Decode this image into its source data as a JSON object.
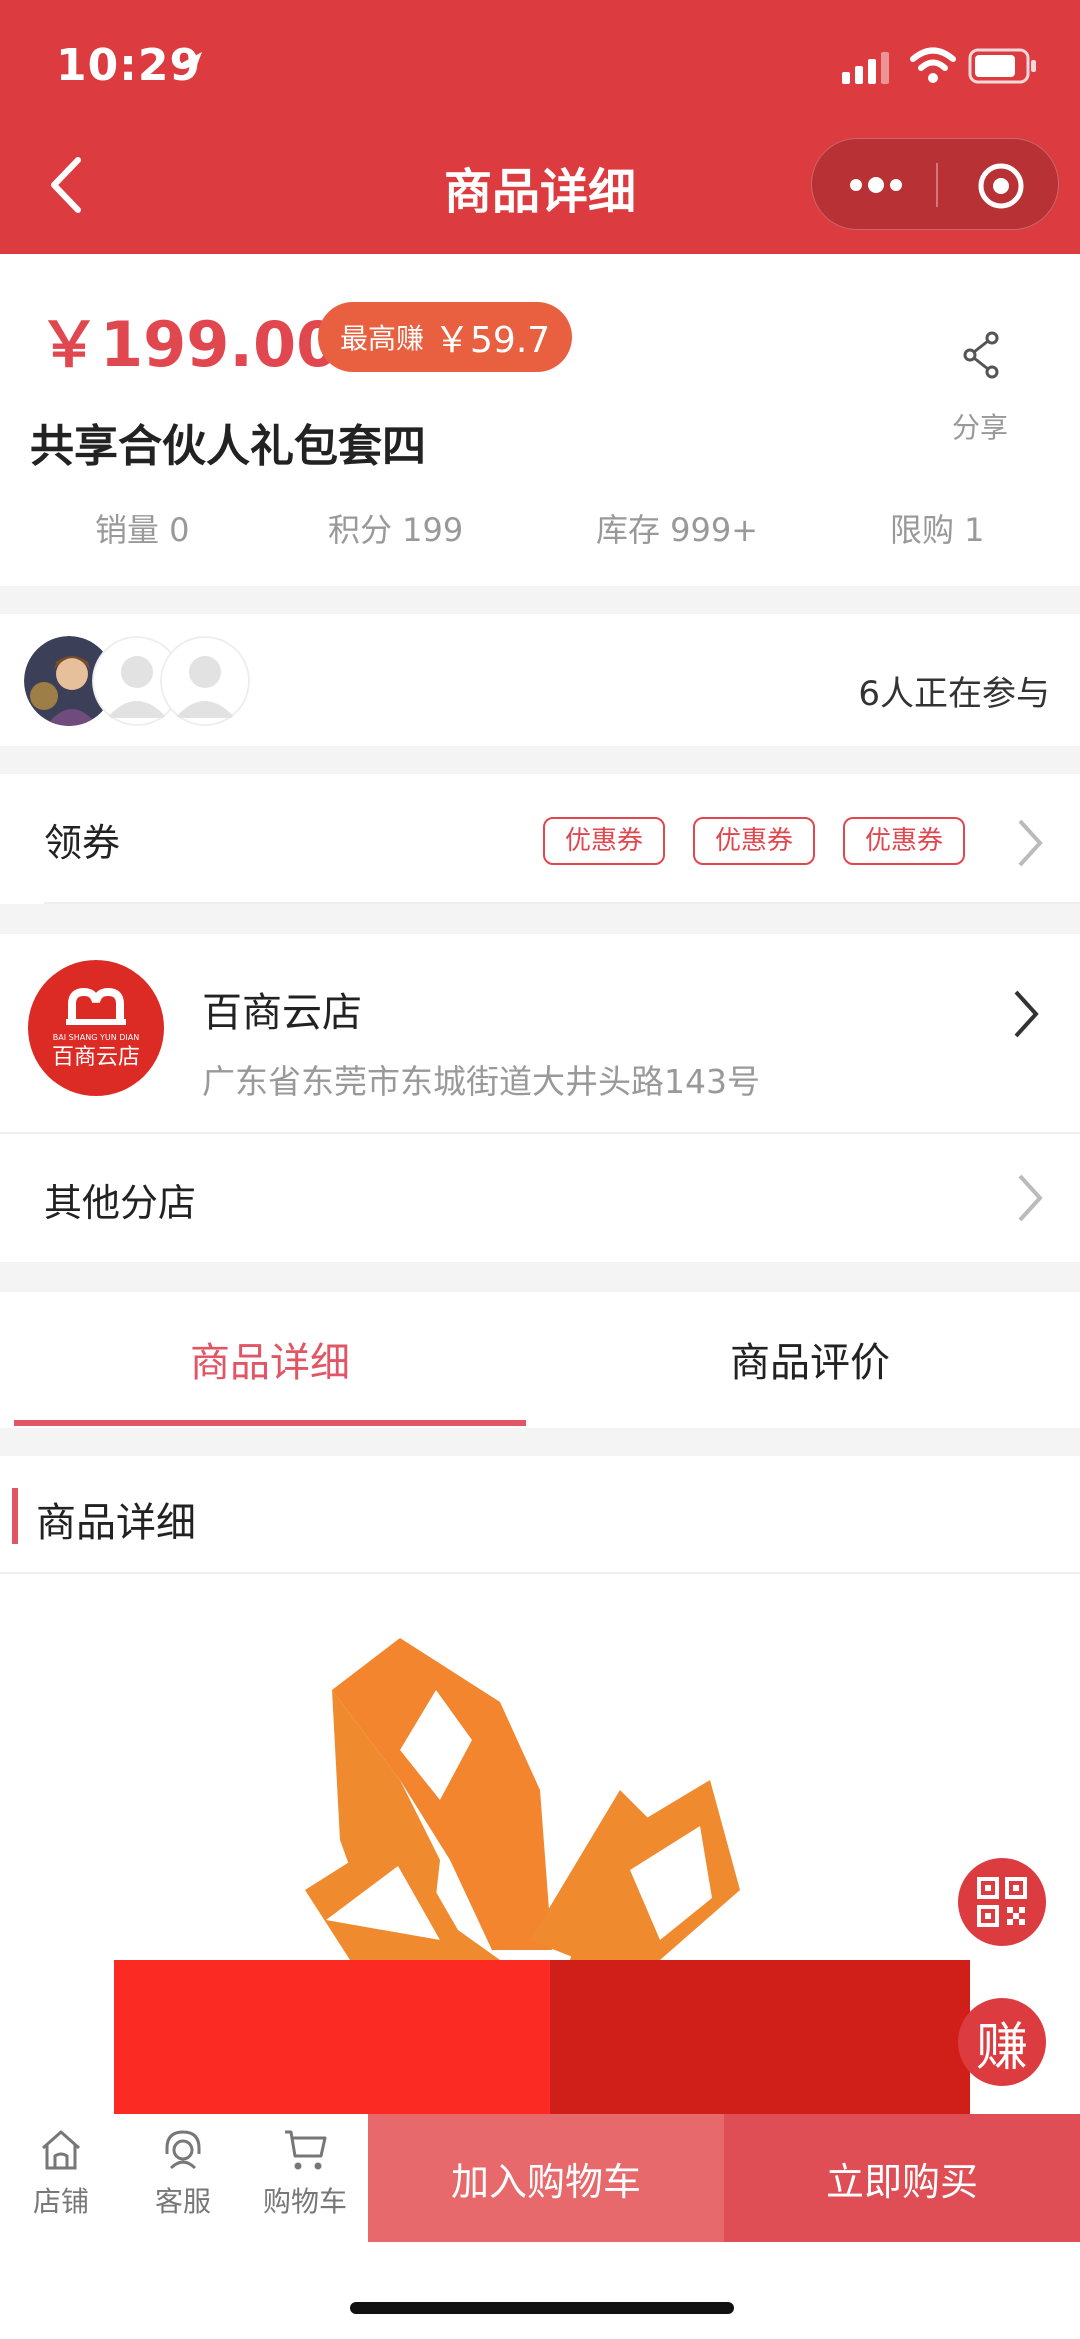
{
  "status_bar": {
    "time": "10:29"
  },
  "nav": {
    "title": "商品详细"
  },
  "product": {
    "price": "￥199.00",
    "earn_label": "最高赚",
    "earn_value": "￥59.7",
    "share_label": "分享",
    "name": "共享合伙人礼包套四",
    "stats": [
      {
        "label": "销量 0"
      },
      {
        "label": "积分 199"
      },
      {
        "label": "库存 999+"
      },
      {
        "label": "限购 1"
      }
    ]
  },
  "participants": {
    "text": "6人正在参与"
  },
  "coupons": {
    "title": "领券",
    "items": [
      "优惠券",
      "优惠券",
      "优惠券"
    ]
  },
  "shop": {
    "name": "百商云店",
    "address": "广东省东莞市东城街道大井头路143号",
    "logo_text": "百商云店",
    "logo_subtext": "BAI SHANG YUN DIAN",
    "other_branches": "其他分店"
  },
  "tabs": [
    {
      "label": "商品详细",
      "active": true
    },
    {
      "label": "商品评价",
      "active": false
    }
  ],
  "detail": {
    "section_title": "商品详细"
  },
  "float_buttons": {
    "earn_label": "赚"
  },
  "bottom_bar": {
    "items": [
      {
        "label": "店铺",
        "icon": "store-icon"
      },
      {
        "label": "客服",
        "icon": "customer-service-icon"
      },
      {
        "label": "购物车",
        "icon": "cart-icon"
      }
    ],
    "add_to_cart": "加入购物车",
    "buy_now": "立即购买"
  },
  "colors": {
    "accent": "#dc3b3f",
    "price": "#e0474f",
    "tab_active": "#e15564"
  }
}
